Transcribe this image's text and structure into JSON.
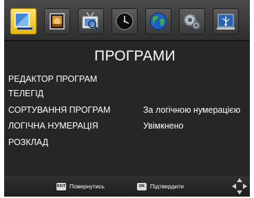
{
  "menu": {
    "title": "ПРОГРАМИ",
    "items": [
      {
        "label": "РЕДАКТОР ПРОГРАМ",
        "value": ""
      },
      {
        "label": "ТЕЛЕГІД",
        "value": ""
      },
      {
        "label": "СОРТУВАННЯ ПРОГРАМ",
        "value": "За логічною нумерацією"
      },
      {
        "label": "ЛОГІЧНА НУМЕРАЦІЯ",
        "value": "Увімкнено"
      },
      {
        "label": "РОЗКЛАД",
        "value": ""
      }
    ]
  },
  "icon_bar": {
    "tabs": [
      {
        "icon": "channel-manager-icon",
        "selected": true
      },
      {
        "icon": "picture-icon",
        "selected": false
      },
      {
        "icon": "channel-search-icon",
        "selected": false
      },
      {
        "icon": "time-icon",
        "selected": false
      },
      {
        "icon": "globe-icon",
        "selected": false
      },
      {
        "icon": "settings-gears-icon",
        "selected": false
      },
      {
        "icon": "usb-icon",
        "selected": false
      }
    ]
  },
  "footer": {
    "back_key": "EXIT",
    "back_label": "Повернутись",
    "ok_key": "OK",
    "ok_label": "Підтвердити"
  },
  "colors": {
    "background": "#262626",
    "selected_tab": "#f5c518",
    "text": "#ffffff"
  }
}
